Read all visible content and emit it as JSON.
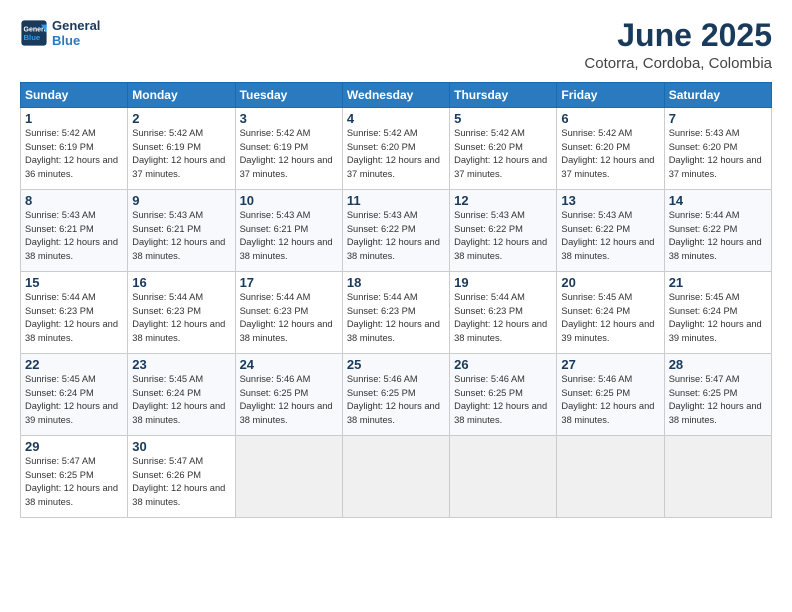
{
  "header": {
    "logo_line1": "General",
    "logo_line2": "Blue",
    "month": "June 2025",
    "location": "Cotorra, Cordoba, Colombia"
  },
  "weekdays": [
    "Sunday",
    "Monday",
    "Tuesday",
    "Wednesday",
    "Thursday",
    "Friday",
    "Saturday"
  ],
  "weeks": [
    [
      {
        "day": "1",
        "sunrise": "5:42 AM",
        "sunset": "6:19 PM",
        "daylight": "12 hours and 36 minutes."
      },
      {
        "day": "2",
        "sunrise": "5:42 AM",
        "sunset": "6:19 PM",
        "daylight": "12 hours and 37 minutes."
      },
      {
        "day": "3",
        "sunrise": "5:42 AM",
        "sunset": "6:19 PM",
        "daylight": "12 hours and 37 minutes."
      },
      {
        "day": "4",
        "sunrise": "5:42 AM",
        "sunset": "6:20 PM",
        "daylight": "12 hours and 37 minutes."
      },
      {
        "day": "5",
        "sunrise": "5:42 AM",
        "sunset": "6:20 PM",
        "daylight": "12 hours and 37 minutes."
      },
      {
        "day": "6",
        "sunrise": "5:42 AM",
        "sunset": "6:20 PM",
        "daylight": "12 hours and 37 minutes."
      },
      {
        "day": "7",
        "sunrise": "5:43 AM",
        "sunset": "6:20 PM",
        "daylight": "12 hours and 37 minutes."
      }
    ],
    [
      {
        "day": "8",
        "sunrise": "5:43 AM",
        "sunset": "6:21 PM",
        "daylight": "12 hours and 38 minutes."
      },
      {
        "day": "9",
        "sunrise": "5:43 AM",
        "sunset": "6:21 PM",
        "daylight": "12 hours and 38 minutes."
      },
      {
        "day": "10",
        "sunrise": "5:43 AM",
        "sunset": "6:21 PM",
        "daylight": "12 hours and 38 minutes."
      },
      {
        "day": "11",
        "sunrise": "5:43 AM",
        "sunset": "6:22 PM",
        "daylight": "12 hours and 38 minutes."
      },
      {
        "day": "12",
        "sunrise": "5:43 AM",
        "sunset": "6:22 PM",
        "daylight": "12 hours and 38 minutes."
      },
      {
        "day": "13",
        "sunrise": "5:43 AM",
        "sunset": "6:22 PM",
        "daylight": "12 hours and 38 minutes."
      },
      {
        "day": "14",
        "sunrise": "5:44 AM",
        "sunset": "6:22 PM",
        "daylight": "12 hours and 38 minutes."
      }
    ],
    [
      {
        "day": "15",
        "sunrise": "5:44 AM",
        "sunset": "6:23 PM",
        "daylight": "12 hours and 38 minutes."
      },
      {
        "day": "16",
        "sunrise": "5:44 AM",
        "sunset": "6:23 PM",
        "daylight": "12 hours and 38 minutes."
      },
      {
        "day": "17",
        "sunrise": "5:44 AM",
        "sunset": "6:23 PM",
        "daylight": "12 hours and 38 minutes."
      },
      {
        "day": "18",
        "sunrise": "5:44 AM",
        "sunset": "6:23 PM",
        "daylight": "12 hours and 38 minutes."
      },
      {
        "day": "19",
        "sunrise": "5:44 AM",
        "sunset": "6:23 PM",
        "daylight": "12 hours and 38 minutes."
      },
      {
        "day": "20",
        "sunrise": "5:45 AM",
        "sunset": "6:24 PM",
        "daylight": "12 hours and 39 minutes."
      },
      {
        "day": "21",
        "sunrise": "5:45 AM",
        "sunset": "6:24 PM",
        "daylight": "12 hours and 39 minutes."
      }
    ],
    [
      {
        "day": "22",
        "sunrise": "5:45 AM",
        "sunset": "6:24 PM",
        "daylight": "12 hours and 39 minutes."
      },
      {
        "day": "23",
        "sunrise": "5:45 AM",
        "sunset": "6:24 PM",
        "daylight": "12 hours and 38 minutes."
      },
      {
        "day": "24",
        "sunrise": "5:46 AM",
        "sunset": "6:25 PM",
        "daylight": "12 hours and 38 minutes."
      },
      {
        "day": "25",
        "sunrise": "5:46 AM",
        "sunset": "6:25 PM",
        "daylight": "12 hours and 38 minutes."
      },
      {
        "day": "26",
        "sunrise": "5:46 AM",
        "sunset": "6:25 PM",
        "daylight": "12 hours and 38 minutes."
      },
      {
        "day": "27",
        "sunrise": "5:46 AM",
        "sunset": "6:25 PM",
        "daylight": "12 hours and 38 minutes."
      },
      {
        "day": "28",
        "sunrise": "5:47 AM",
        "sunset": "6:25 PM",
        "daylight": "12 hours and 38 minutes."
      }
    ],
    [
      {
        "day": "29",
        "sunrise": "5:47 AM",
        "sunset": "6:25 PM",
        "daylight": "12 hours and 38 minutes."
      },
      {
        "day": "30",
        "sunrise": "5:47 AM",
        "sunset": "6:26 PM",
        "daylight": "12 hours and 38 minutes."
      },
      null,
      null,
      null,
      null,
      null
    ]
  ]
}
